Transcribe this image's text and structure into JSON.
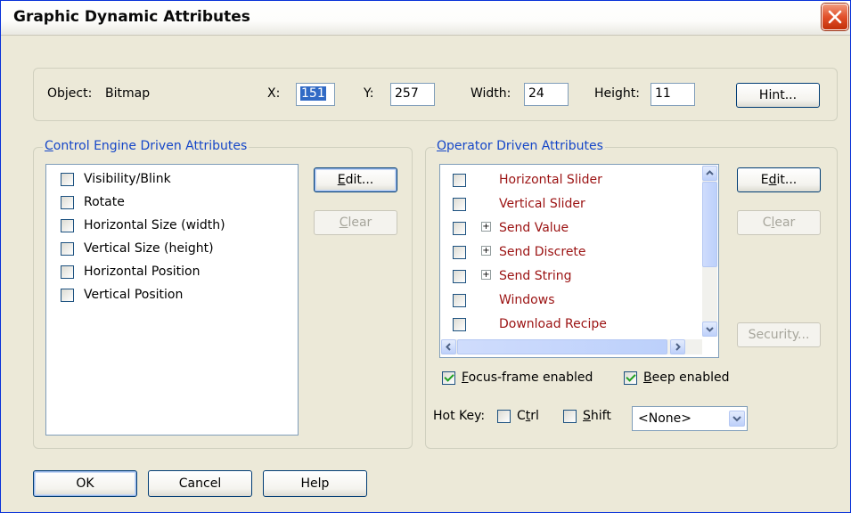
{
  "window": {
    "title": "Graphic Dynamic Attributes"
  },
  "object_row": {
    "object_label": "Object:",
    "object_value": "Bitmap",
    "x_label": "X:",
    "x_value": "151",
    "y_label": "Y:",
    "y_value": "257",
    "width_label": "Width:",
    "width_value": "24",
    "height_label": "Height:",
    "height_value": "11",
    "hint_button": "Hint..."
  },
  "control_group": {
    "title_accel": "C",
    "title_rest": "ontrol Engine Driven Attributes",
    "items": [
      {
        "label": "Visibility/Blink",
        "checked": false
      },
      {
        "label": "Rotate",
        "checked": false
      },
      {
        "label": "Horizontal Size (width)",
        "checked": false
      },
      {
        "label": "Vertical Size (height)",
        "checked": false
      },
      {
        "label": "Horizontal Position",
        "checked": false
      },
      {
        "label": "Vertical Position",
        "checked": false
      }
    ],
    "edit_accel": "E",
    "edit_rest": "dit...",
    "clear_accel": "C",
    "clear_rest": "lear"
  },
  "operator_group": {
    "title_accel": "O",
    "title_rest": "perator Driven Attributes",
    "items": [
      {
        "label": "Horizontal Slider",
        "expandable": false,
        "checked": false
      },
      {
        "label": "Vertical Slider",
        "expandable": false,
        "checked": false
      },
      {
        "label": "Send Value",
        "expandable": true,
        "checked": false
      },
      {
        "label": "Send Discrete",
        "expandable": true,
        "checked": false
      },
      {
        "label": "Send String",
        "expandable": true,
        "checked": false
      },
      {
        "label": "Windows",
        "expandable": false,
        "checked": false
      },
      {
        "label": "Download Recipe",
        "expandable": false,
        "checked": false
      }
    ],
    "edit_pre": "E",
    "edit_accel": "d",
    "edit_rest": "it...",
    "clear_pre": "C",
    "clear_accel": "l",
    "clear_rest": "ear",
    "security_button": "Security...",
    "focus_accel": "F",
    "focus_rest": "ocus-frame enabled",
    "focus_checked": true,
    "beep_accel": "B",
    "beep_rest": "eep enabled",
    "beep_checked": true,
    "hotkey_label": "Hot Key:",
    "ctrl_pre": "C",
    "ctrl_accel": "t",
    "ctrl_rest": "rl",
    "shift_accel": "S",
    "shift_rest": "hift",
    "hotkey_value": "<None>"
  },
  "footer": {
    "ok": "OK",
    "cancel": "Cancel",
    "help": "Help"
  },
  "colors": {
    "title_blue": "#1546c8",
    "operator_item": "#9b1212",
    "selection": "#316ac5"
  },
  "icons": [
    "close-icon",
    "chevron-up-icon",
    "chevron-down-icon",
    "chevron-left-icon",
    "chevron-right-icon",
    "plus-icon",
    "check-icon"
  ]
}
